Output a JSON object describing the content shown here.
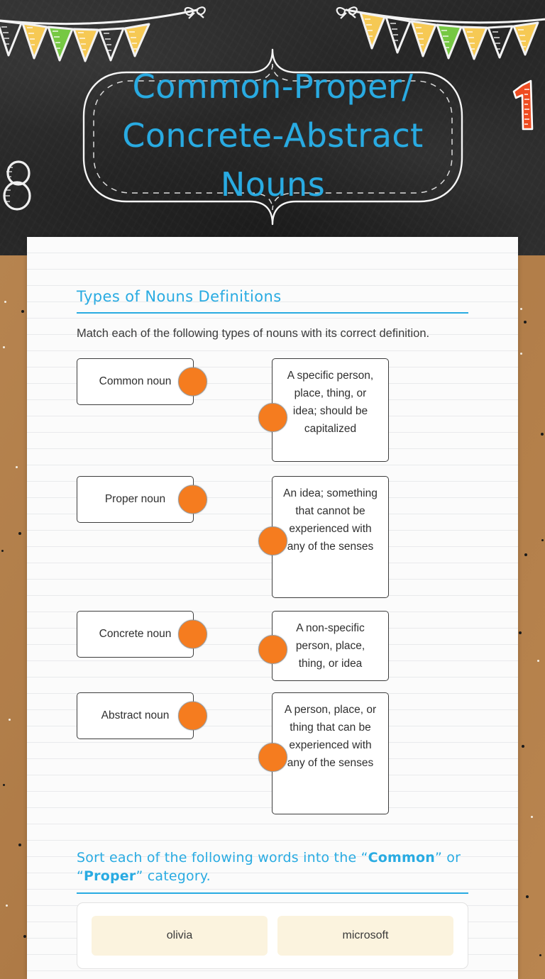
{
  "header": {
    "title": "Common-Proper/\nConcrete-Abstract\nNouns",
    "decorations": {
      "left_number": "8",
      "right_number": "1"
    },
    "colors": {
      "chalkboard": "#2b2b2b",
      "title_cyan": "#29ABE2",
      "flag_yellow": "#F6C954",
      "flag_green": "#76C843",
      "ruler_orange": "#EF4C21"
    },
    "bunting": {
      "left_flags": [
        "outline",
        "yellow",
        "green",
        "yellow",
        "outline",
        "yellow"
      ],
      "right_flags": [
        "yellow",
        "outline",
        "yellow",
        "green",
        "yellow",
        "outline",
        "yellow"
      ]
    }
  },
  "worksheet": {
    "background_color": "#b5804c",
    "paper_color": "#fbfbfb",
    "accent_color": "#29ABE2",
    "dot_color": "#F57C1F",
    "card_color": "#fbf3de",
    "sections": {
      "definitions": {
        "heading": "Types of Nouns  Definitions",
        "instructions": "Match each of the following types of nouns with its correct definition.",
        "pairs": [
          {
            "term": "Common noun",
            "definition": "A specific person, place, thing, or idea; should be capitalized"
          },
          {
            "term": "Proper noun",
            "definition": "An idea; something that cannot be experienced with any of the senses"
          },
          {
            "term": "Concrete noun",
            "definition": "A non-specific person, place, thing, or idea"
          },
          {
            "term": "Abstract noun",
            "definition": "A person, place, or thing that can be experienced with any of the senses"
          }
        ]
      },
      "sorting": {
        "heading_parts": {
          "before": "Sort each of the following words into the “",
          "bold_one": "Common",
          "middle": "” or “",
          "bold_two": "Proper",
          "after": "” category."
        },
        "words": [
          "olivia",
          "microsoft"
        ]
      }
    }
  }
}
